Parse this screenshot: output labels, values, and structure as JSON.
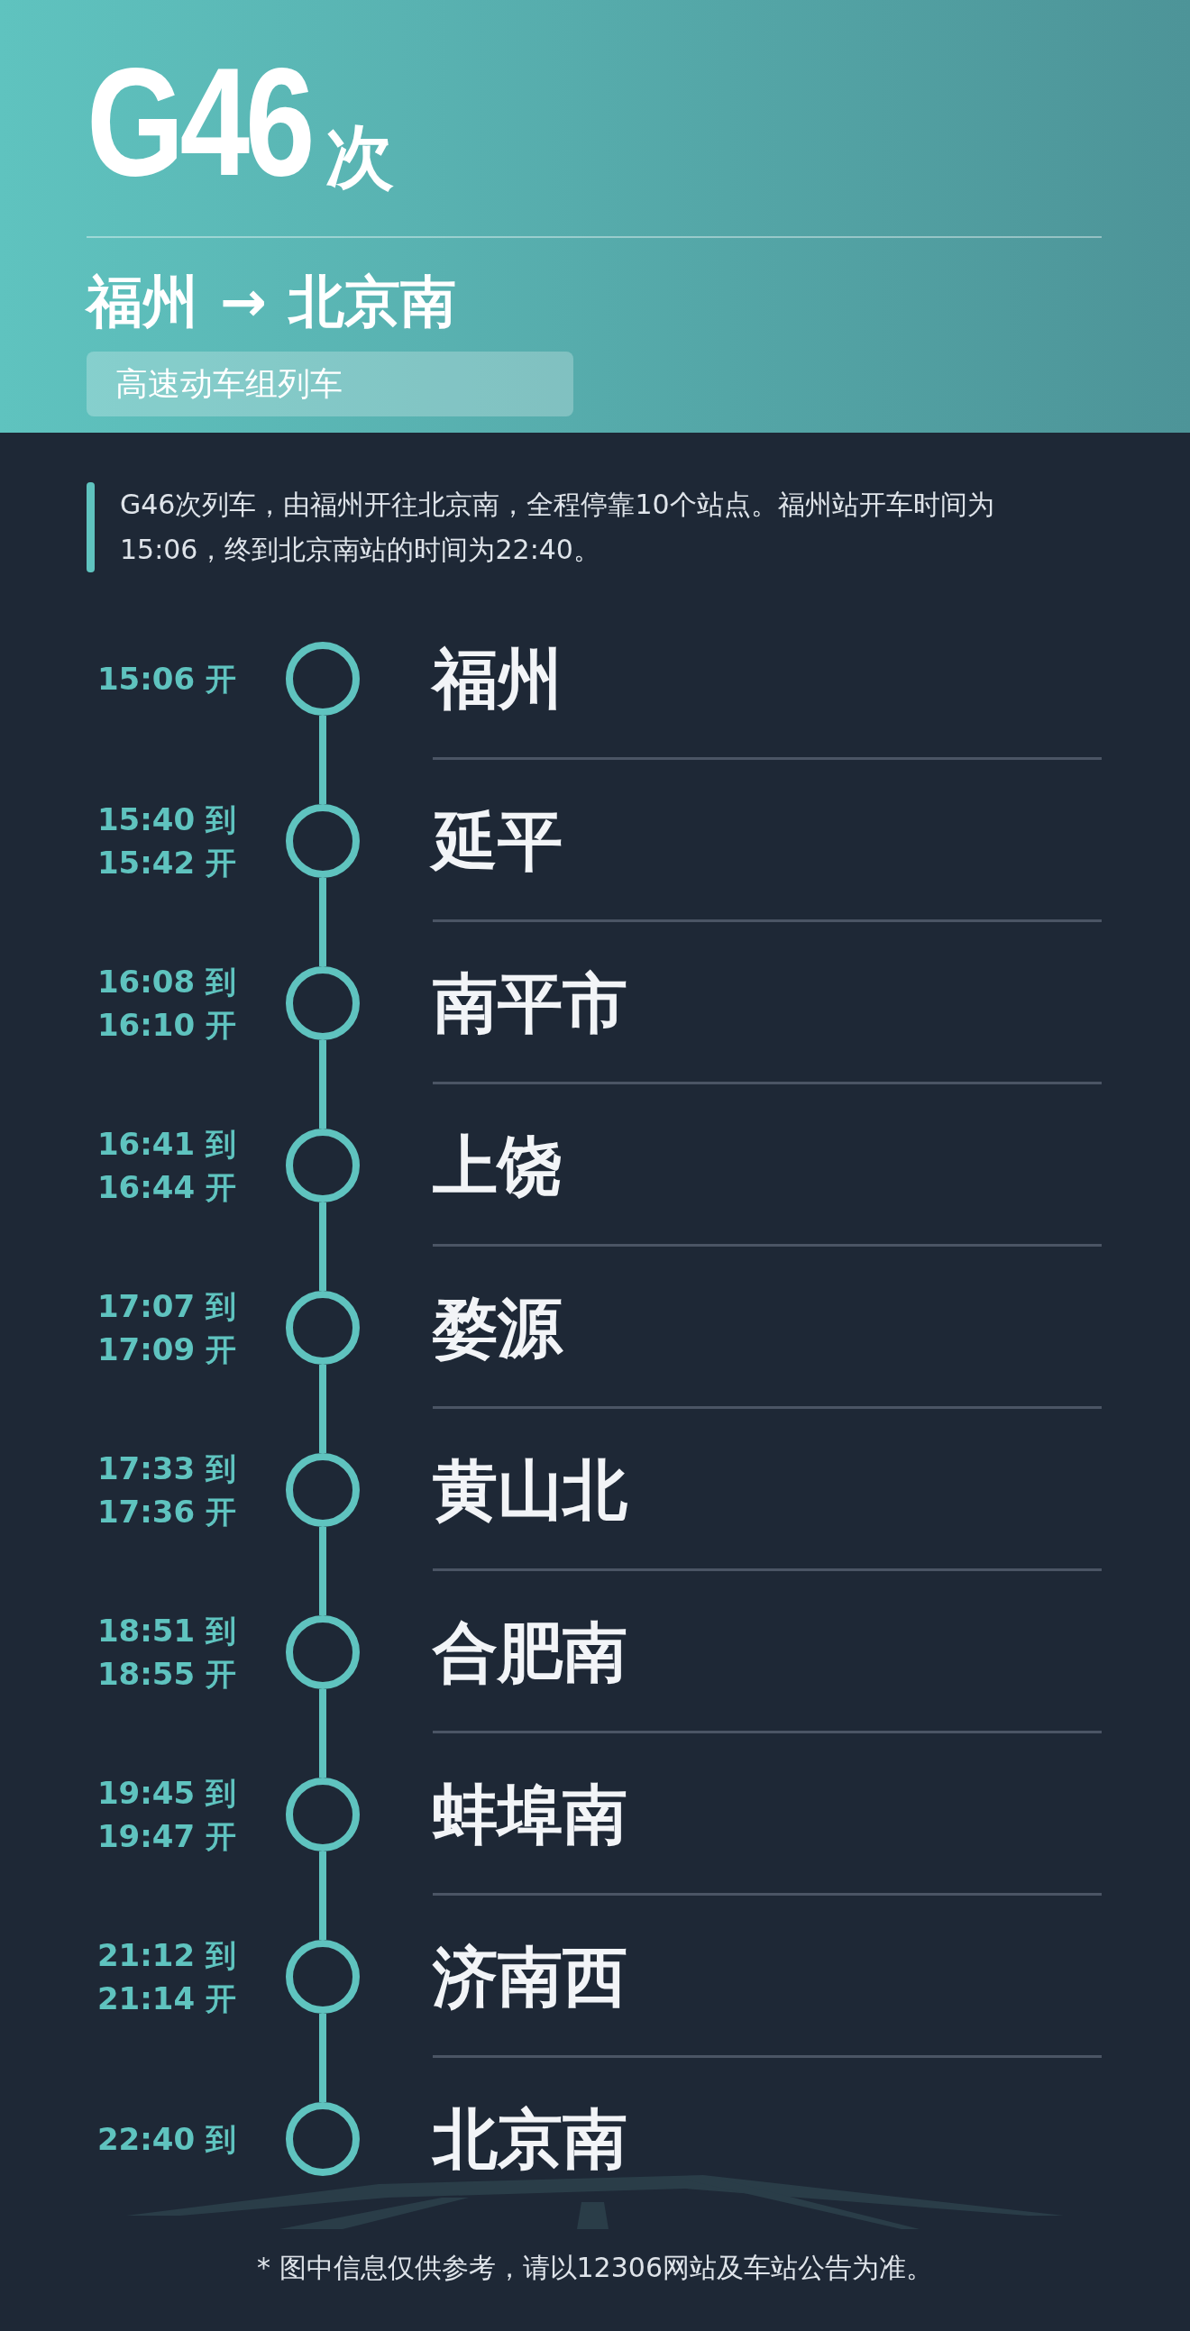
{
  "header": {
    "train_number": "G46",
    "suffix": "次",
    "route_from": "福州",
    "route_arrow": "→",
    "route_to": "北京南",
    "train_type": "高速动车组列车"
  },
  "intro": "G46次列车，由福州开往北京南，全程停靠10个站点。福州站开车时间为15:06，终到北京南站的时间为22:40。",
  "stations": [
    {
      "name": "福州",
      "times": [
        "15:06 开"
      ]
    },
    {
      "name": "延平",
      "times": [
        "15:40 到",
        "15:42 开"
      ]
    },
    {
      "name": "南平市",
      "times": [
        "16:08 到",
        "16:10 开"
      ]
    },
    {
      "name": "上饶",
      "times": [
        "16:41 到",
        "16:44 开"
      ]
    },
    {
      "name": "婺源",
      "times": [
        "17:07 到",
        "17:09 开"
      ]
    },
    {
      "name": "黄山北",
      "times": [
        "17:33 到",
        "17:36 开"
      ]
    },
    {
      "name": "合肥南",
      "times": [
        "18:51 到",
        "18:55 开"
      ]
    },
    {
      "name": "蚌埠南",
      "times": [
        "19:45 到",
        "19:47 开"
      ]
    },
    {
      "name": "济南西",
      "times": [
        "21:12 到",
        "21:14 开"
      ]
    },
    {
      "name": "北京南",
      "times": [
        "22:40 到"
      ]
    }
  ],
  "footer_note": "* 图中信息仅供参考，请以12306网站及车站公告为准。"
}
